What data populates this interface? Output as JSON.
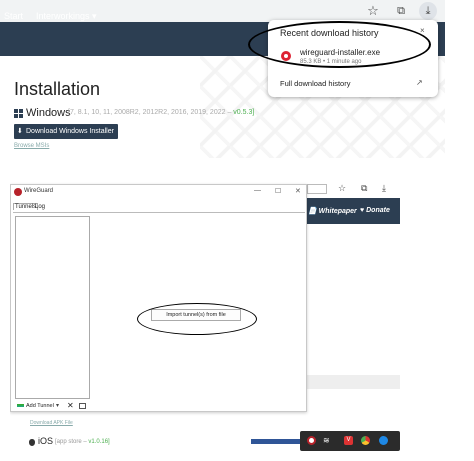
{
  "browser": {
    "star_icon": "star-icon",
    "extensions_icon": "puzzle-icon",
    "download_icon": "download-icon"
  },
  "site_nav": {
    "start": "Start",
    "interworkings": "Interworkings ▾"
  },
  "installation": {
    "title": "Installation",
    "windows_label": "Windows",
    "windows_versions": "[7, 8.1, 10, 11, 2008R2, 2012R2, 2016, 2019, 2022 –",
    "windows_version_num": "v0.5.3]",
    "download_button": "Download Windows Installer",
    "browse_msis": "Browse MSIs"
  },
  "download_popup": {
    "title": "Recent download history",
    "close_icon": "×",
    "filename": "wireguard-installer.exe",
    "meta": "85.3 KB • 1 minute ago",
    "full_history": "Full download history",
    "open_icon": "↗"
  },
  "background_site": {
    "whitepaper": "Whitepaper",
    "donate": "Donate",
    "apk_link": "Download APK File",
    "ios_label": "iOS",
    "ios_store": "[app store –",
    "ios_version": "v1.0.16]"
  },
  "wireguard_window": {
    "title": "WireGuard",
    "min": "—",
    "max": "☐",
    "close": "✕",
    "tabs": [
      "Tunnels",
      "Log"
    ],
    "add_tunnel": "Add Tunnel",
    "add_tunnel_dropdown": "▾",
    "delete_icon": "✕",
    "import_button": "Import tunnel(s) from file"
  },
  "tray": {
    "vivaldi": "V",
    "wifi": "≋"
  },
  "colors": {
    "nav_bg": "#2c3e52",
    "accent_green": "#4caf50",
    "wireguard_red": "#b7222a",
    "arrow_blue": "#2f5597"
  }
}
